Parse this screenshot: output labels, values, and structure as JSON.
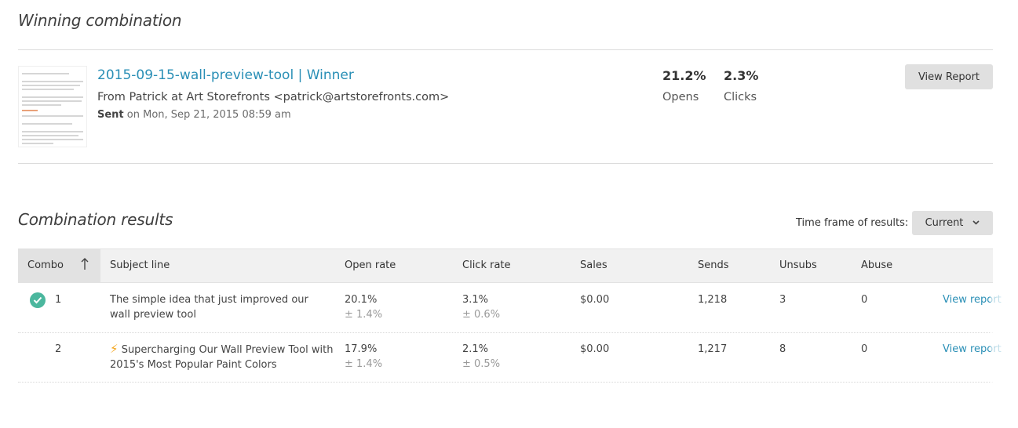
{
  "winning": {
    "section_title": "Winning combination",
    "campaign_title": "2015-09-15-wall-preview-tool | Winner",
    "from_line": "From Patrick at Art Storefronts <patrick@artstorefronts.com>",
    "sent_label": "Sent",
    "sent_text": "on Mon, Sep 21, 2015 08:59 am",
    "opens_value": "21.2%",
    "opens_label": "Opens",
    "clicks_value": "2.3%",
    "clicks_label": "Clicks",
    "view_report_label": "View Report"
  },
  "results": {
    "section_title": "Combination results",
    "timeframe_label": "Time frame of results:",
    "timeframe_value": "Current",
    "columns": {
      "combo": "Combo",
      "subject": "Subject line",
      "open_rate": "Open rate",
      "click_rate": "Click rate",
      "sales": "Sales",
      "sends": "Sends",
      "unsubs": "Unsubs",
      "abuse": "Abuse"
    },
    "rows": [
      {
        "combo": "1",
        "winner": true,
        "subject": "The simple idea that just improved our wall preview tool",
        "open_rate": "20.1%",
        "open_margin": "± 1.4%",
        "click_rate": "3.1%",
        "click_margin": "± 0.6%",
        "sales": "$0.00",
        "sends": "1,218",
        "unsubs": "3",
        "abuse": "0",
        "action": "View report"
      },
      {
        "combo": "2",
        "winner": false,
        "subject": "Supercharging Our Wall Preview Tool with 2015's Most Popular Paint Colors",
        "open_rate": "17.9%",
        "open_margin": "± 1.4%",
        "click_rate": "2.1%",
        "click_margin": "± 0.5%",
        "sales": "$0.00",
        "sends": "1,217",
        "unsubs": "8",
        "abuse": "0",
        "action": "View report"
      }
    ]
  },
  "icons": {
    "winner": "check-circle-icon",
    "sort": "arrow-up-icon",
    "dropdown": "chevron-down-icon",
    "subject_emoji": "lightning-bolt-icon"
  },
  "colors": {
    "link": "#2a8fb6",
    "winner_check": "#4bb79e",
    "button_bg": "#e0e0e0",
    "bolt": "#f3a51d"
  }
}
